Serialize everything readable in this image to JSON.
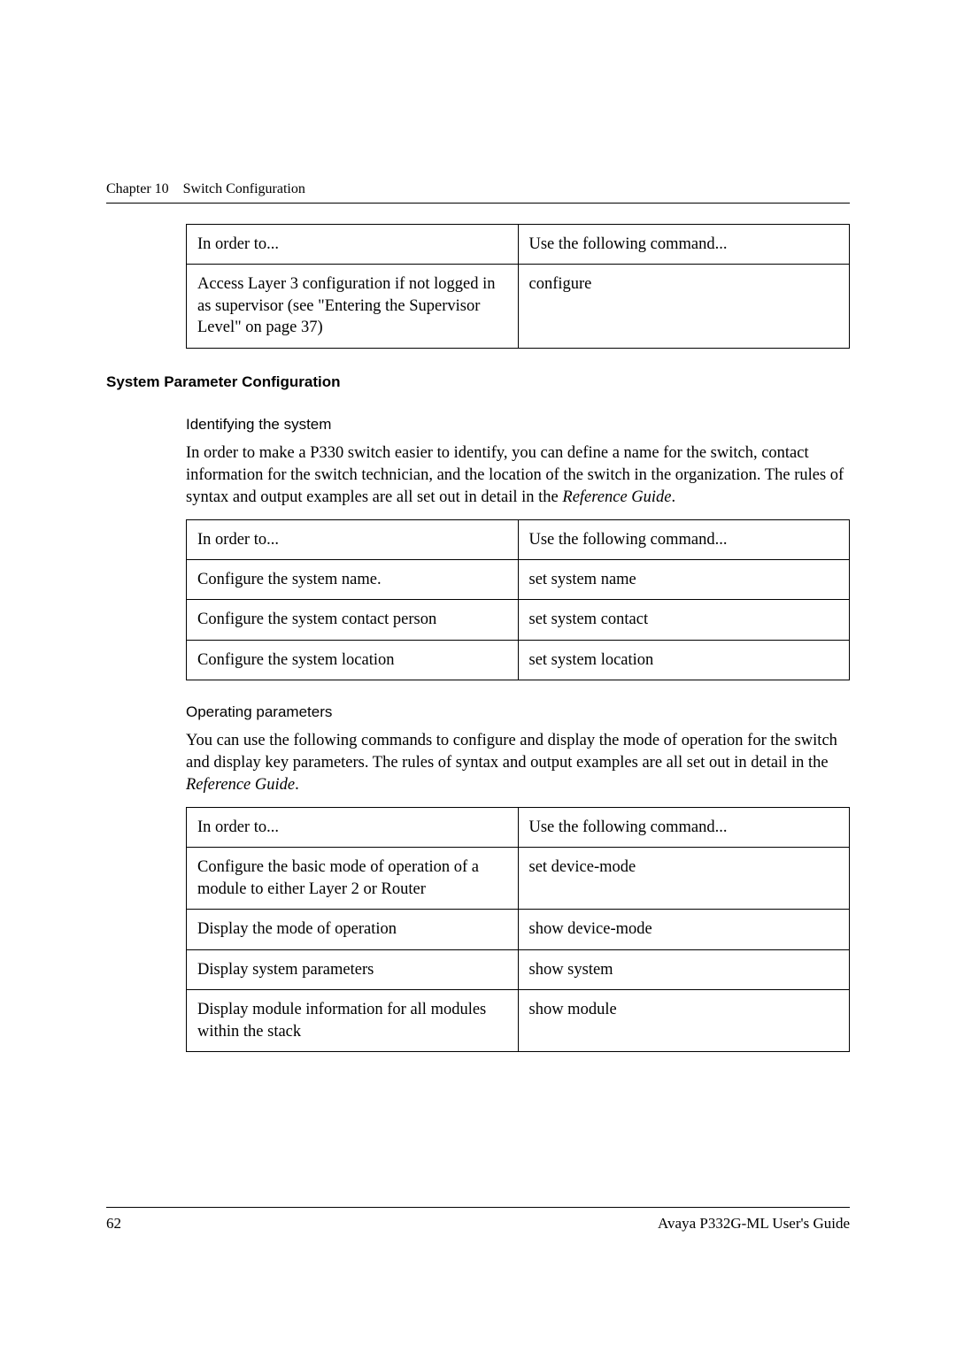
{
  "header": {
    "chapter": "Chapter 10",
    "chapter_title": "Switch Configuration"
  },
  "table1": {
    "header_left": "In order to...",
    "header_right": "Use the following command...",
    "row1_left": "Access Layer 3 configuration if not logged in as supervisor (see \"Entering the Supervisor Level\" on page 37)",
    "row1_right": "configure"
  },
  "section1": {
    "title": "System Parameter Configuration",
    "sub1": {
      "title": "Identifying the system",
      "para_a": "In order to make a P330 switch easier to identify, you can define a name for the switch, contact information for the switch technician, and the location of the switch in the organization. The rules of syntax and output examples are all set out in detail in the ",
      "para_b": "Reference Guide",
      "para_c": "."
    },
    "table2": {
      "header_left": "In order to...",
      "header_right": "Use the following command...",
      "row1_left": "Configure the system name.",
      "row1_right": "set system name",
      "row2_left": "Configure the system contact person",
      "row2_right": "set system contact",
      "row3_left": "Configure the system location",
      "row3_right": "set system location"
    },
    "sub2": {
      "title": "Operating parameters",
      "para_a": "You can use the following commands to configure and display the mode of operation for the switch and display key parameters. The rules of syntax and output examples are all set out in detail in the ",
      "para_b": "Reference Guide",
      "para_c": "."
    },
    "table3": {
      "header_left": "In order to...",
      "header_right": "Use the following command...",
      "row1_left": "Configure the basic mode of operation of a module to either Layer 2 or Router",
      "row1_right": "set device-mode",
      "row2_left": "Display the mode of operation",
      "row2_right": "show device-mode",
      "row3_left": "Display system parameters",
      "row3_right": "show system",
      "row4_left": "Display module information for all modules within the stack",
      "row4_right": "show module"
    }
  },
  "footer": {
    "page_number": "62",
    "doc_title": "Avaya P332G-ML User's Guide"
  }
}
